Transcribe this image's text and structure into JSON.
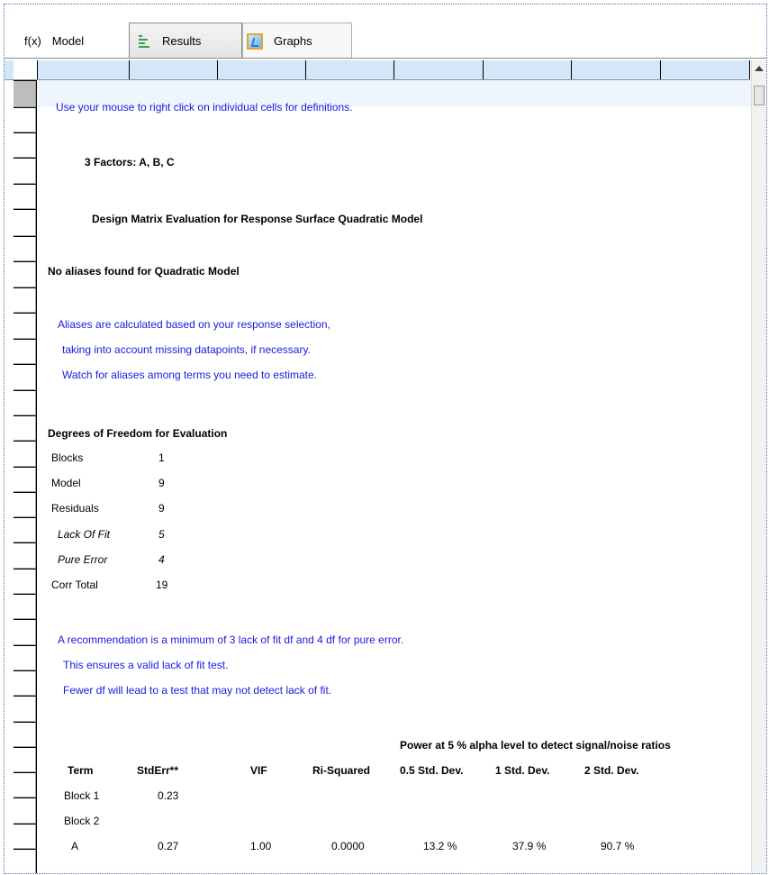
{
  "tabs": [
    {
      "icon": "fx-icon",
      "icon_text": "f(x)",
      "label": "Model"
    },
    {
      "icon": "results-icon",
      "label": "Results"
    },
    {
      "icon": "graphs-icon",
      "label": "Graphs"
    }
  ],
  "hint": "Use your mouse to right click on individual cells for definitions.",
  "factors": "3 Factors: A, B, C",
  "title": "Design Matrix Evaluation for Response Surface Quadratic Model",
  "no_aliases": "No aliases found for Quadratic Model",
  "alias_notes": [
    "Aliases are calculated based on your response selection,",
    "taking into account missing datapoints, if necessary.",
    "Watch for aliases among terms you need to estimate."
  ],
  "dof_title": "Degrees of Freedom for Evaluation",
  "dof": [
    {
      "label": "Blocks",
      "value": "1"
    },
    {
      "label": "Model",
      "value": "9"
    },
    {
      "label": "Residuals",
      "value": "9"
    },
    {
      "label": "Lack Of Fit",
      "value": "5"
    },
    {
      "label": "Pure Error",
      "value": "4"
    },
    {
      "label": "Corr Total",
      "value": "19"
    }
  ],
  "recommendation": [
    "A recommendation is a minimum of 3 lack of fit df and 4 df for pure error.",
    "This ensures a valid lack of fit test.",
    "Fewer df will lead to a test that may not detect lack of fit."
  ],
  "power_header": "Power at 5 % alpha level to detect signal/noise ratios",
  "table": {
    "headers": [
      "Term",
      "StdErr**",
      "VIF",
      "Ri-Squared",
      "0.5 Std. Dev.",
      "1 Std. Dev.",
      "2 Std. Dev."
    ],
    "rows": [
      [
        "Block 1",
        "0.23",
        "",
        "",
        "",
        "",
        ""
      ],
      [
        "Block 2",
        "",
        "",
        "",
        "",
        "",
        ""
      ],
      [
        "A",
        "0.27",
        "1.00",
        "0.0000",
        "13.2 %",
        "37.9 %",
        "90.7 %"
      ]
    ]
  },
  "colors": {
    "accent_blue": "#1a1adb",
    "header_band": "#d4e6f7",
    "hint_band": "#eef5fc"
  }
}
